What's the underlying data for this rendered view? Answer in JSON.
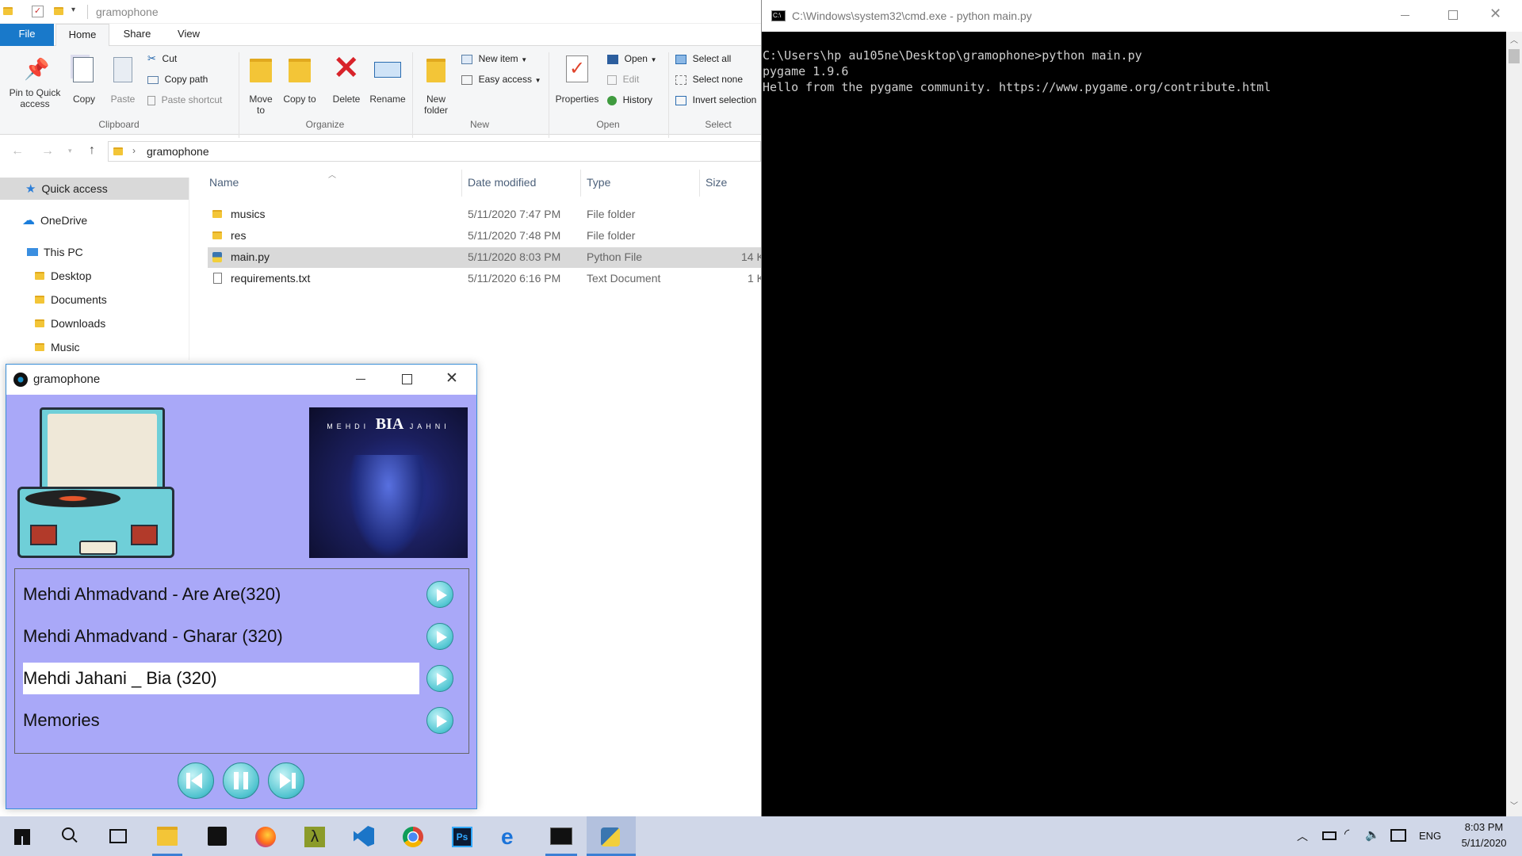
{
  "explorer": {
    "title": "gramophone",
    "tabs": [
      "File",
      "Home",
      "Share",
      "View"
    ],
    "ribbon": {
      "clipboard": {
        "pin": "Pin to Quick access",
        "copy": "Copy",
        "paste": "Paste",
        "cut": "Cut",
        "copy_path": "Copy path",
        "paste_shortcut": "Paste shortcut",
        "label": "Clipboard"
      },
      "organize": {
        "move": "Move to",
        "copy": "Copy to",
        "delete": "Delete",
        "rename": "Rename",
        "label": "Organize"
      },
      "new": {
        "folder": "New folder",
        "item": "New item",
        "easy": "Easy access",
        "label": "New"
      },
      "open": {
        "properties": "Properties",
        "open": "Open",
        "edit": "Edit",
        "history": "History",
        "label": "Open"
      },
      "select": {
        "all": "Select all",
        "none": "Select none",
        "invert": "Invert selection",
        "label": "Select"
      }
    },
    "breadcrumb": "gramophone",
    "sidebar": [
      "Quick access",
      "OneDrive",
      "This PC",
      "Desktop",
      "Documents",
      "Downloads",
      "Music"
    ],
    "columns": [
      "Name",
      "Date modified",
      "Type",
      "Size"
    ],
    "files": [
      {
        "name": "musics",
        "date": "5/11/2020 7:47 PM",
        "type": "File folder",
        "size": ""
      },
      {
        "name": "res",
        "date": "5/11/2020 7:48 PM",
        "type": "File folder",
        "size": ""
      },
      {
        "name": "main.py",
        "date": "5/11/2020 8:03 PM",
        "type": "Python File",
        "size": "14 K"
      },
      {
        "name": "requirements.txt",
        "date": "5/11/2020 6:16 PM",
        "type": "Text Document",
        "size": "1 K"
      }
    ]
  },
  "cmd": {
    "title": "C:\\Windows\\system32\\cmd.exe - python  main.py",
    "lines": [
      "C:\\Users\\hp au105ne\\Desktop\\gramophone>python main.py",
      "pygame 1.9.6",
      "Hello from the pygame community. https://www.pygame.org/contribute.html"
    ]
  },
  "player": {
    "title": "gramophone",
    "cover": {
      "artist_left": "MEHDI",
      "logo": "BIA",
      "artist_right": "JAHNI"
    },
    "songs": [
      "Mehdi Ahmadvand - Are Are(320)",
      "Mehdi Ahmadvand - Gharar (320)",
      "Mehdi Jahani _ Bia (320)",
      "Memories"
    ],
    "selected_index": 2,
    "bg_color": "#a9a8f8"
  },
  "taskbar": {
    "lang": "ENG",
    "time": "8:03 PM",
    "date": "5/11/2020"
  }
}
